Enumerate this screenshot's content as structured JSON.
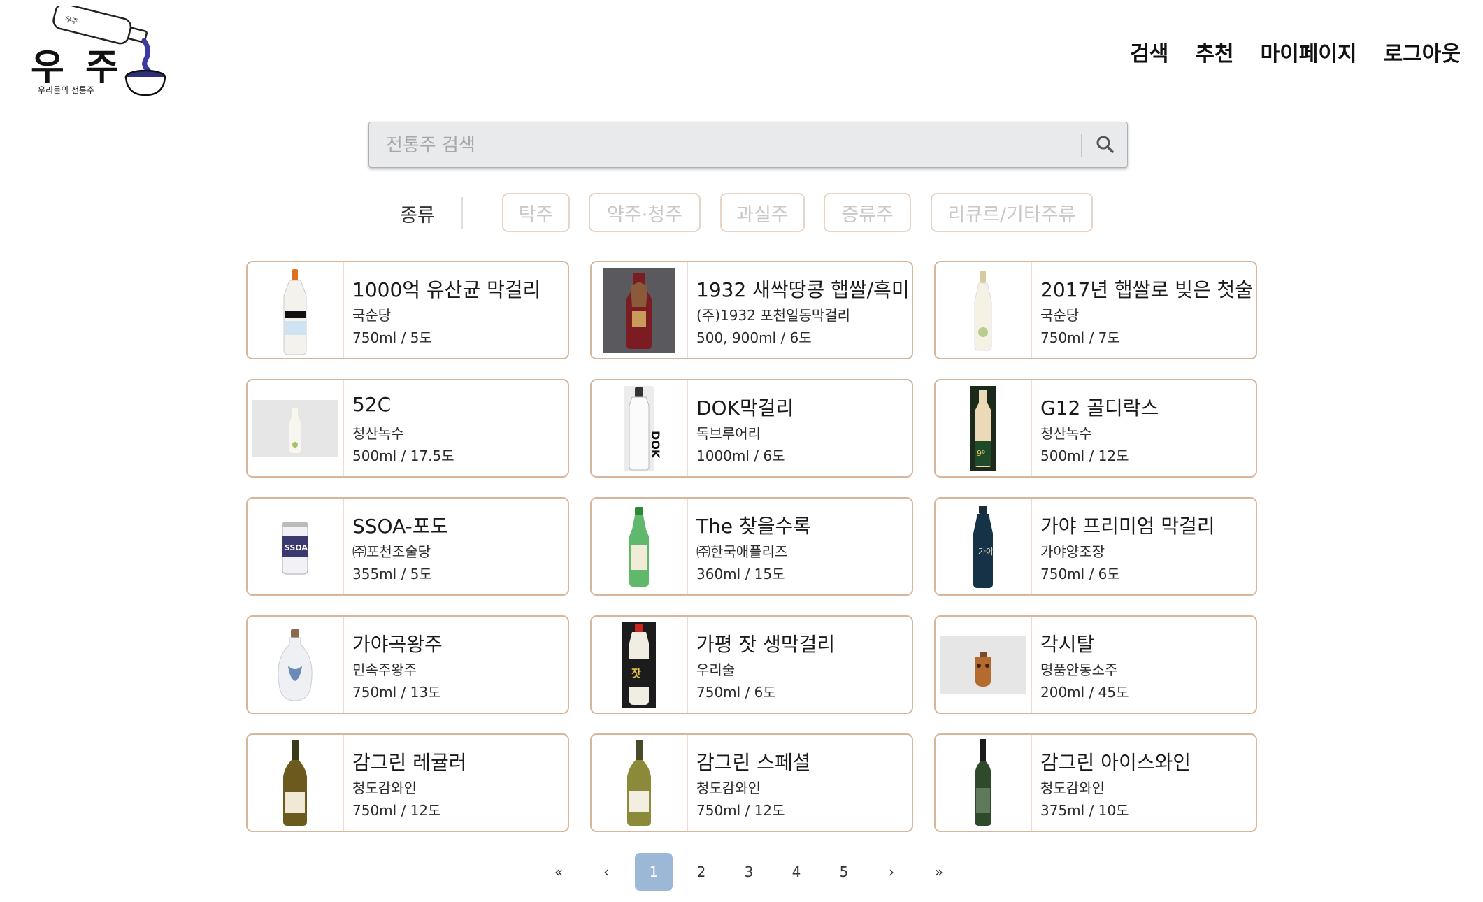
{
  "header": {
    "logo_text": "우 주",
    "logo_subtitle": "우리들의 전통주",
    "nav": [
      "검색",
      "추천",
      "마이페이지",
      "로그아웃"
    ]
  },
  "search": {
    "placeholder": "전통주 검색",
    "value": ""
  },
  "filters": {
    "label": "종류",
    "chips": [
      "탁주",
      "약주·청주",
      "과실주",
      "증류주",
      "리큐르/기타주류"
    ]
  },
  "products": [
    {
      "name": "1000억 유산균 막걸리",
      "maker": "국순당",
      "spec": "750ml / 5도",
      "thumb": "white-bottle"
    },
    {
      "name": "1932 새싹땅콩 햅쌀/흑미",
      "maker": "(주)1932 포천일동막걸리",
      "spec": "500, 900ml / 6도",
      "thumb": "dark-bottle"
    },
    {
      "name": "2017년 햅쌀로 빚은 첫술",
      "maker": "국순당",
      "spec": "750ml / 7도",
      "thumb": "slim-bottle"
    },
    {
      "name": "52C",
      "maker": "청산녹수",
      "spec": "500ml / 17.5도",
      "thumb": "small-bottle-gray"
    },
    {
      "name": "DOK막걸리",
      "maker": "독브루어리",
      "spec": "1000ml / 6도",
      "thumb": "dok-bottle"
    },
    {
      "name": "G12 골디락스",
      "maker": "청산녹수",
      "spec": "500ml / 12도",
      "thumb": "gold-bottle"
    },
    {
      "name": "SSOA-포도",
      "maker": "㈜포천조술당",
      "spec": "355ml / 5도",
      "thumb": "can"
    },
    {
      "name": "The 찾을수록",
      "maker": "㈜한국애플리즈",
      "spec": "360ml / 15도",
      "thumb": "green-bottle"
    },
    {
      "name": "가야 프리미엄 막걸리",
      "maker": "가야양조장",
      "spec": "750ml / 6도",
      "thumb": "navy-bottle"
    },
    {
      "name": "가야곡왕주",
      "maker": "민속주왕주",
      "spec": "750ml / 13도",
      "thumb": "ceramic-jar"
    },
    {
      "name": "가평 잣 생막걸리",
      "maker": "우리술",
      "spec": "750ml / 6도",
      "thumb": "black-bottle"
    },
    {
      "name": "각시탈",
      "maker": "명품안동소주",
      "spec": "200ml / 45도",
      "thumb": "mask-bottle"
    },
    {
      "name": "감그린 레귤러",
      "maker": "청도감와인",
      "spec": "750ml / 12도",
      "thumb": "wine-bottle"
    },
    {
      "name": "감그린 스페셜",
      "maker": "청도감와인",
      "spec": "750ml / 12도",
      "thumb": "wine-bottle-light"
    },
    {
      "name": "감그린 아이스와인",
      "maker": "청도감와인",
      "spec": "375ml / 10도",
      "thumb": "ice-wine-bottle"
    }
  ],
  "pagination": {
    "first": "«",
    "prev": "‹",
    "pages": [
      "1",
      "2",
      "3",
      "4",
      "5"
    ],
    "current": "1",
    "next": "›",
    "last": "»"
  },
  "colors": {
    "card_border": "#d7b79c",
    "chip_border": "#e6d4c4",
    "page_active": "#9db8d6"
  }
}
